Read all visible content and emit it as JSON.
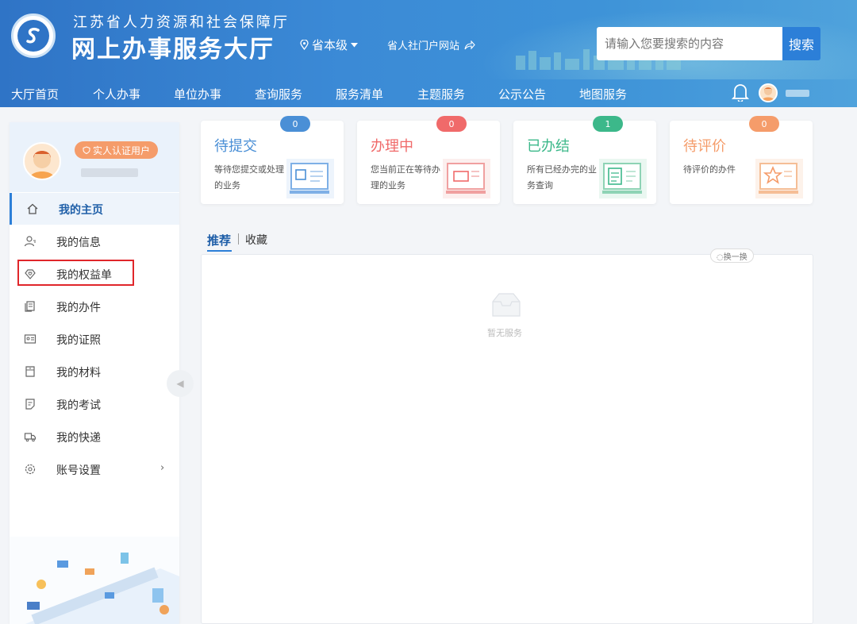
{
  "header": {
    "org_name": "江苏省人力资源和社会保障厅",
    "site_name": "网上办事服务大厅",
    "level": "省本级",
    "portal_link": "省人社门户网站",
    "search_placeholder": "请输入您要搜索的内容",
    "search_button": "搜索"
  },
  "nav": {
    "items": [
      "大厅首页",
      "个人办事",
      "单位办事",
      "查询服务",
      "服务清单",
      "主题服务",
      "公示公告",
      "地图服务"
    ]
  },
  "profile": {
    "cert_badge": "实人认证用户"
  },
  "sidebar": {
    "items": [
      {
        "label": "我的主页",
        "icon": "home-icon"
      },
      {
        "label": "我的信息",
        "icon": "user-icon"
      },
      {
        "label": "我的权益单",
        "icon": "heart-shield-icon"
      },
      {
        "label": "我的办件",
        "icon": "documents-icon"
      },
      {
        "label": "我的证照",
        "icon": "id-card-icon"
      },
      {
        "label": "我的材料",
        "icon": "folder-icon"
      },
      {
        "label": "我的考试",
        "icon": "exam-icon"
      },
      {
        "label": "我的快递",
        "icon": "truck-icon"
      },
      {
        "label": "账号设置",
        "icon": "gear-icon"
      }
    ],
    "collapse_glyph": "◀"
  },
  "cards": [
    {
      "title": "待提交",
      "desc": "等待您提交或处理的业务",
      "count": "0",
      "color": "#4a8fd6"
    },
    {
      "title": "办理中",
      "desc": "您当前正在等待办理的业务",
      "count": "0",
      "color": "#f06a6a"
    },
    {
      "title": "已办结",
      "desc": "所有已经办完的业务查询",
      "count": "1",
      "color": "#3cb88a"
    },
    {
      "title": "待评价",
      "desc": "待评价的办件",
      "count": "0",
      "color": "#f59c6a"
    }
  ],
  "tabs": {
    "recommend": "推荐",
    "favorite": "收藏"
  },
  "content": {
    "refresh": "◌换一换",
    "empty_text": "暂无服务"
  },
  "colors": {
    "primary": "#2c7fd8",
    "highlight_border": "#e0262a"
  }
}
